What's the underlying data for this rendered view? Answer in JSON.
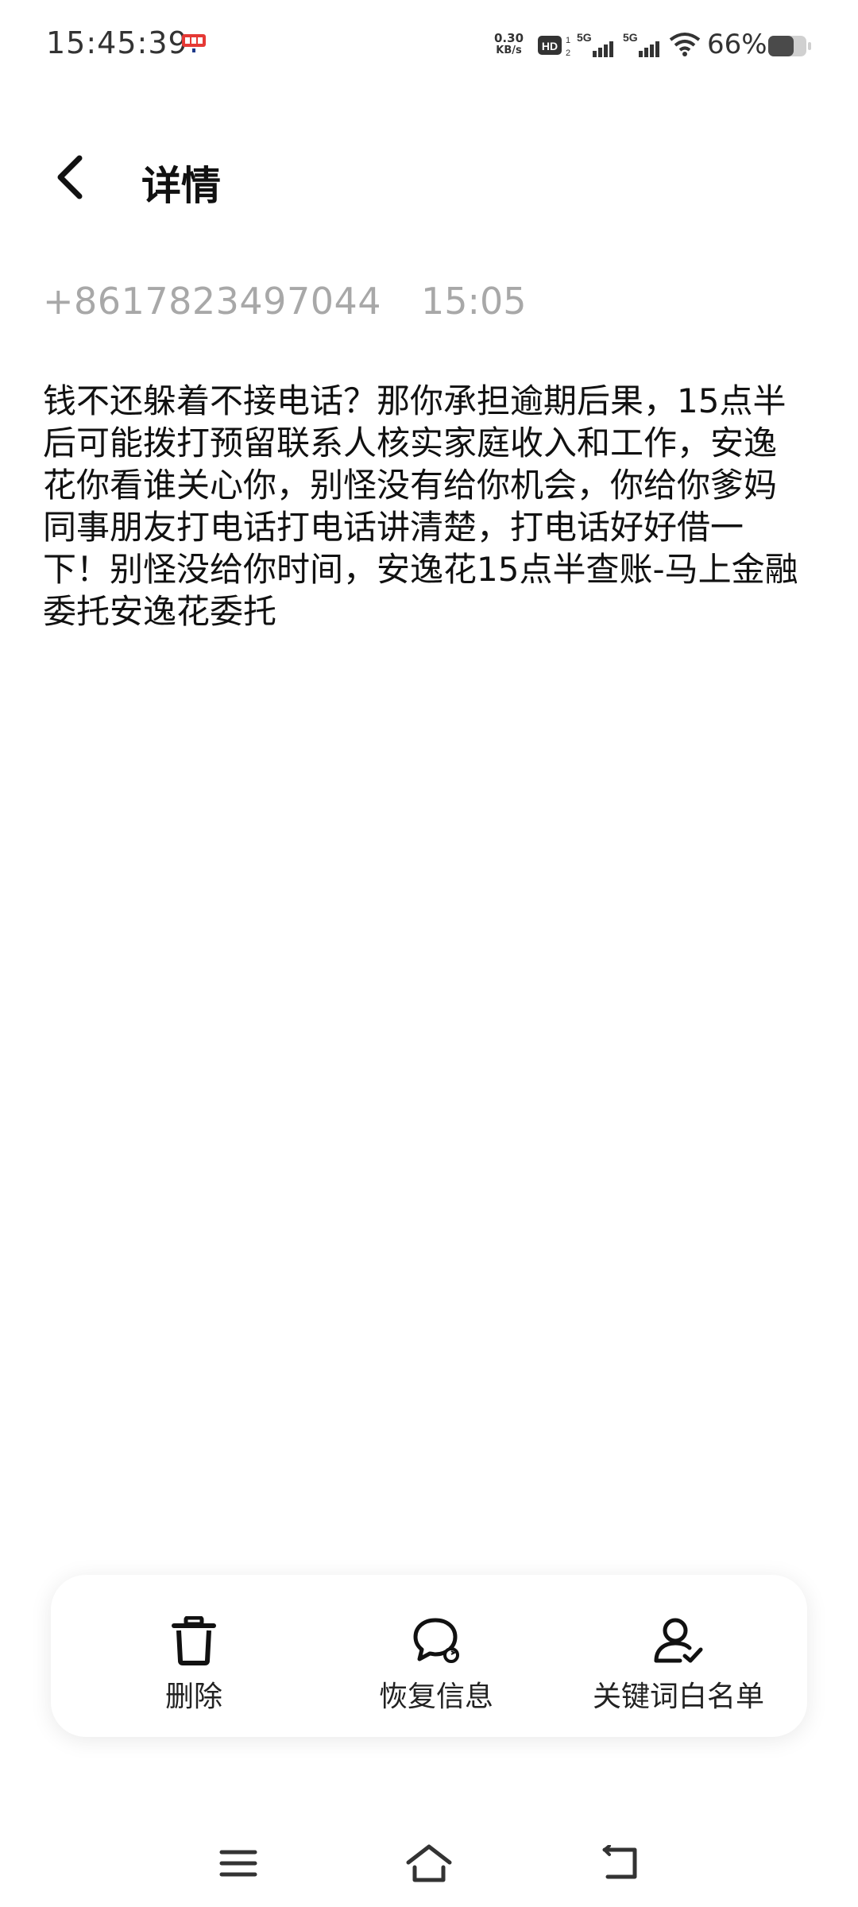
{
  "status_bar": {
    "time": "15:45:39",
    "net_speed_value": "0.30",
    "net_speed_unit": "KB/s",
    "hd_label": "HD",
    "sim1_label": "5G",
    "sim2_label": "5G",
    "battery_percent": "66%",
    "battery_level": 0.66
  },
  "header": {
    "title": "详情"
  },
  "message": {
    "sender": "+8617823497044",
    "time": "15:05",
    "body": "钱不还躲着不接电话？那你承担逾期后果，15点半后可能拨打预留联系人核实家庭收入和工作，安逸花你看谁关心你，别怪没有给你机会，你给你爹妈同事朋友打电话打电话讲清楚，打电话好好借一下！别怪没给你时间，安逸花15点半查账-马上金融委托安逸花委托"
  },
  "actions": {
    "delete_label": "删除",
    "restore_label": "恢复信息",
    "whitelist_label": "关键词白名单"
  },
  "colors": {
    "meta_text": "#a8a8a8",
    "primary_text": "#111111",
    "background": "#ffffff"
  }
}
